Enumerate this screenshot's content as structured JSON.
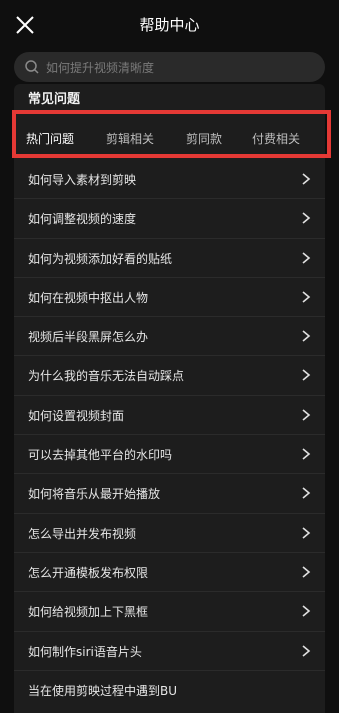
{
  "header": {
    "title": "帮助中心",
    "close_icon": "close-icon"
  },
  "search": {
    "placeholder": "如何提升视频清晰度",
    "icon": "search-icon"
  },
  "section": {
    "title": "常见问题"
  },
  "tabs": [
    {
      "label": "热门问题",
      "active": true
    },
    {
      "label": "剪辑相关",
      "active": false
    },
    {
      "label": "剪同款",
      "active": false
    },
    {
      "label": "付费相关",
      "active": false
    }
  ],
  "questions": [
    "如何导入素材到剪映",
    "如何调整视频的速度",
    "如何为视频添加好看的贴纸",
    "如何在视频中抠出人物",
    "视频后半段黑屏怎么办",
    "为什么我的音乐无法自动踩点",
    "如何设置视频封面",
    "可以去掉其他平台的水印吗",
    "如何将音乐从最开始播放",
    "怎么导出并发布视频",
    "怎么开通模板发布权限",
    "如何给视频加上下黑框",
    "如何制作siri语音片头",
    "当在使用剪映过程中遇到BU"
  ],
  "colors": {
    "accent": "#e53935",
    "background": "#0f0f0f",
    "card": "#1d1d1d"
  }
}
